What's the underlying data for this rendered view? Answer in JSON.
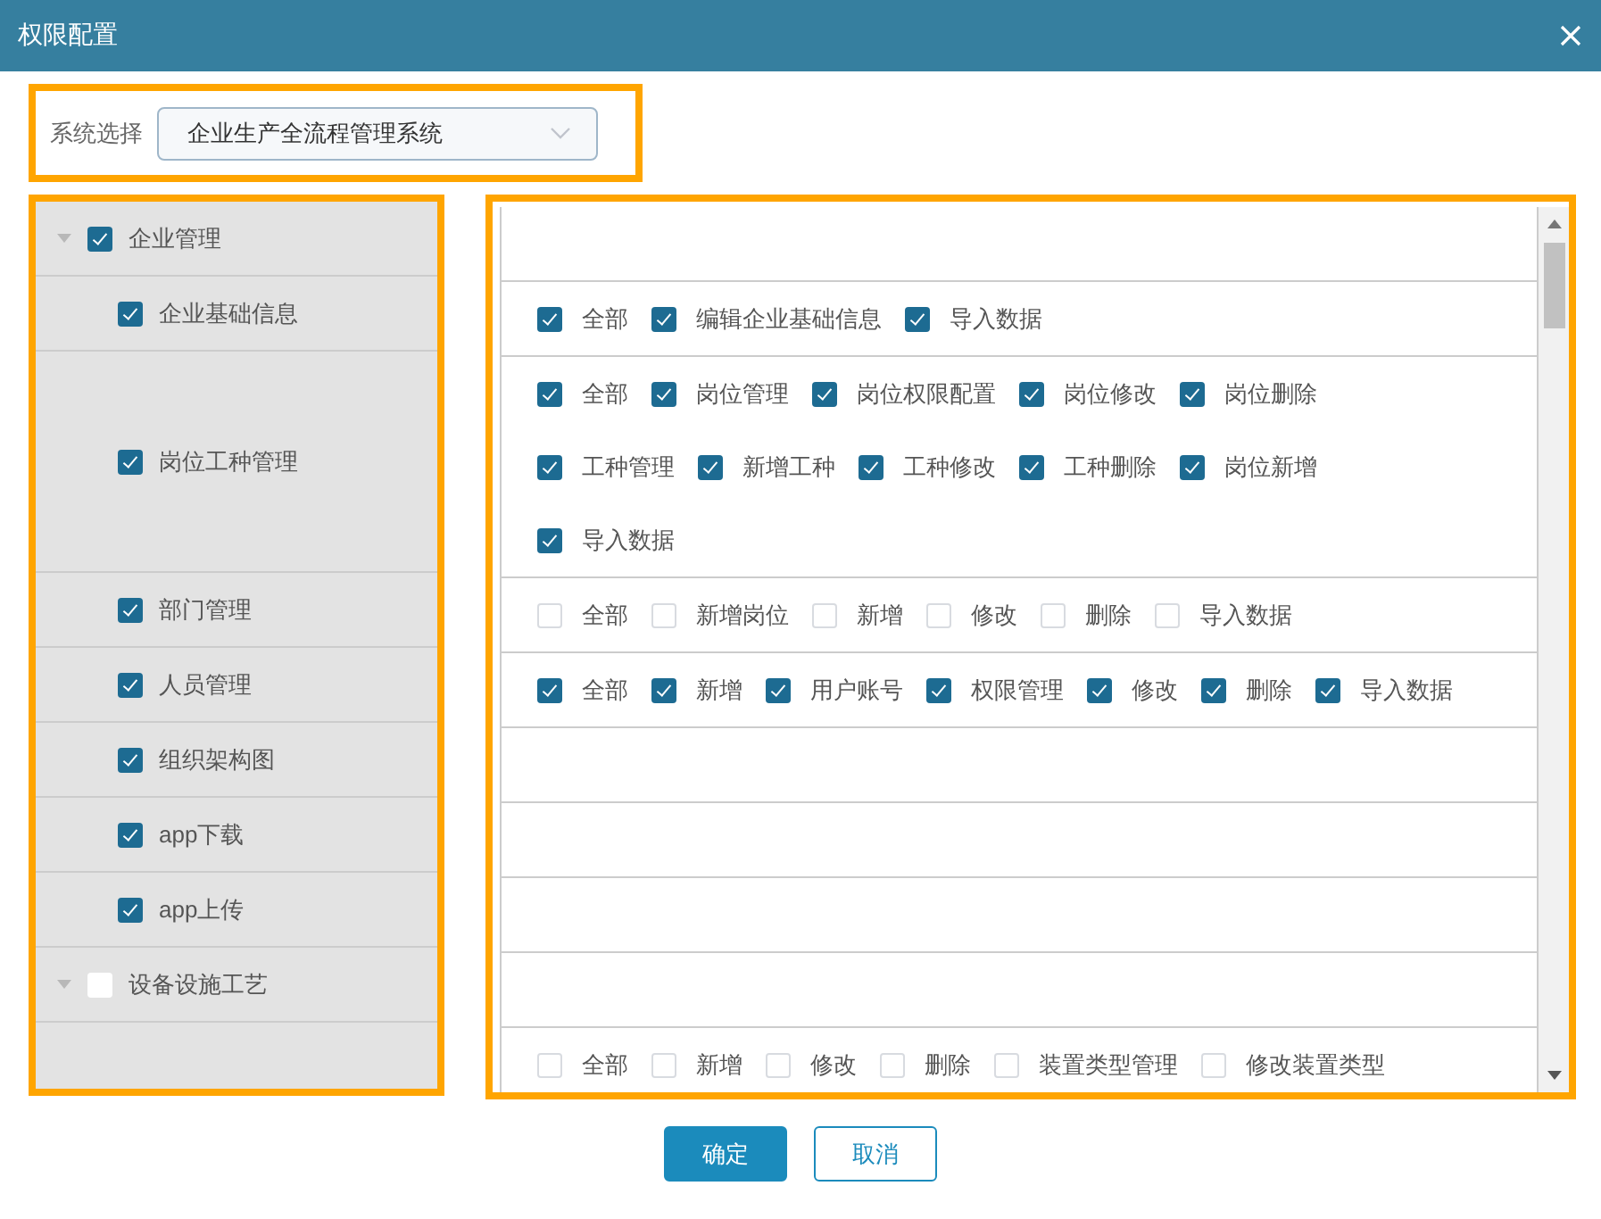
{
  "dialog": {
    "title": "权限配置"
  },
  "system_select": {
    "label": "系统选择",
    "value": "企业生产全流程管理系统"
  },
  "modules": [
    {
      "label": "企业管理",
      "checked": true,
      "expanded": true,
      "children": [
        {
          "label": "企业基础信息",
          "checked": true,
          "permissions": [
            [
              {
                "label": "全部",
                "checked": true
              },
              {
                "label": "编辑企业基础信息",
                "checked": true
              },
              {
                "label": "导入数据",
                "checked": true
              }
            ]
          ]
        },
        {
          "label": "岗位工种管理",
          "checked": true,
          "permissions": [
            [
              {
                "label": "全部",
                "checked": true
              },
              {
                "label": "岗位管理",
                "checked": true
              },
              {
                "label": "岗位权限配置",
                "checked": true
              },
              {
                "label": "岗位修改",
                "checked": true
              },
              {
                "label": "岗位删除",
                "checked": true
              }
            ],
            [
              {
                "label": "工种管理",
                "checked": true
              },
              {
                "label": "新增工种",
                "checked": true
              },
              {
                "label": "工种修改",
                "checked": true
              },
              {
                "label": "工种删除",
                "checked": true
              },
              {
                "label": "岗位新增",
                "checked": true
              }
            ],
            [
              {
                "label": "导入数据",
                "checked": true
              }
            ]
          ]
        },
        {
          "label": "部门管理",
          "checked": true,
          "permissions": [
            [
              {
                "label": "全部",
                "checked": false
              },
              {
                "label": "新增岗位",
                "checked": false
              },
              {
                "label": "新增",
                "checked": false
              },
              {
                "label": "修改",
                "checked": false
              },
              {
                "label": "删除",
                "checked": false
              },
              {
                "label": "导入数据",
                "checked": false
              }
            ]
          ]
        },
        {
          "label": "人员管理",
          "checked": true,
          "permissions": [
            [
              {
                "label": "全部",
                "checked": true
              },
              {
                "label": "新增",
                "checked": true
              },
              {
                "label": "用户账号",
                "checked": true
              },
              {
                "label": "权限管理",
                "checked": true
              },
              {
                "label": "修改",
                "checked": true
              },
              {
                "label": "删除",
                "checked": true
              },
              {
                "label": "导入数据",
                "checked": true
              }
            ]
          ]
        },
        {
          "label": "组织架构图",
          "checked": true
        },
        {
          "label": "app下载",
          "checked": true
        },
        {
          "label": "app上传",
          "checked": true
        }
      ]
    },
    {
      "label": "设备设施工艺",
      "checked": false,
      "expanded": true,
      "children": [
        {
          "permissions": [
            [
              {
                "label": "全部",
                "checked": false
              },
              {
                "label": "新增",
                "checked": false
              },
              {
                "label": "修改",
                "checked": false
              },
              {
                "label": "删除",
                "checked": false
              },
              {
                "label": "装置类型管理",
                "checked": false
              },
              {
                "label": "修改装置类型",
                "checked": false
              }
            ]
          ]
        }
      ]
    }
  ],
  "buttons": [
    {
      "label": "确定",
      "kind": "primary"
    },
    {
      "label": "取消",
      "kind": "secondary"
    }
  ]
}
